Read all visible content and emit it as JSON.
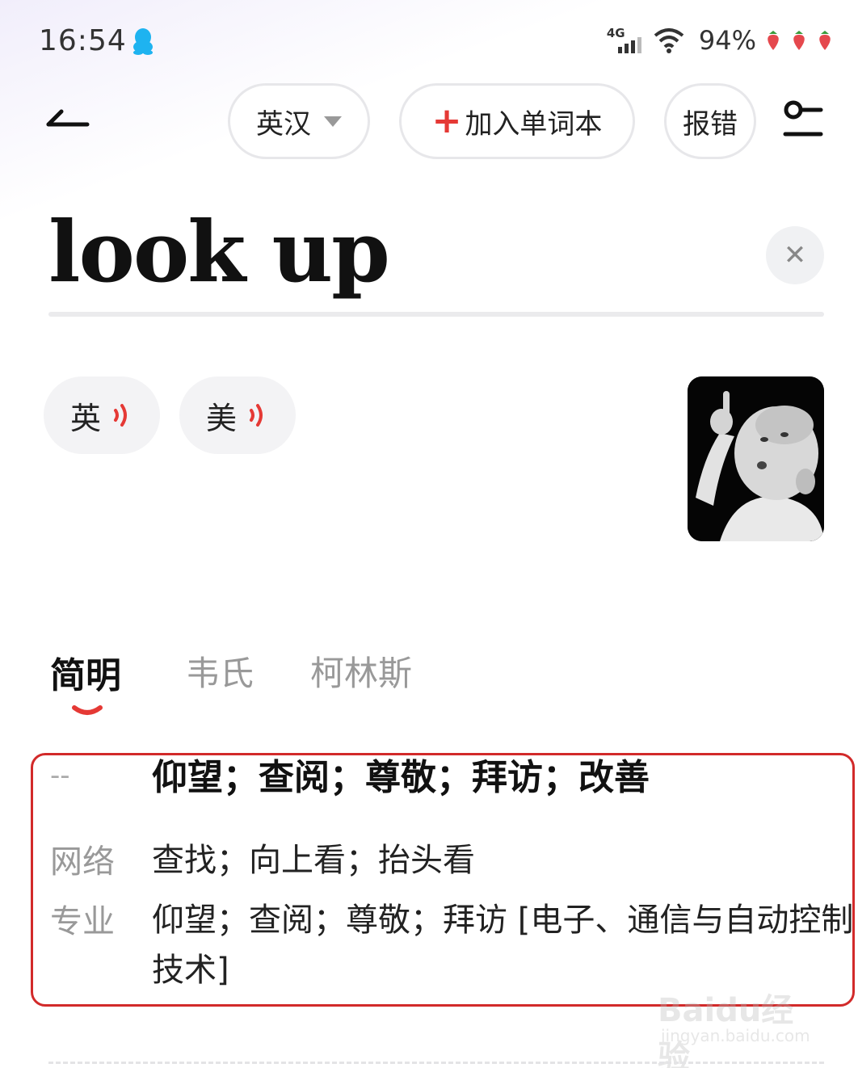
{
  "status_bar": {
    "time": "16:54",
    "network": "4G",
    "battery": "94%"
  },
  "toolbar": {
    "language_label": "英汉",
    "add_label": "加入单词本",
    "add_plus": "+",
    "report_label": "报错"
  },
  "entry": {
    "headword": "look up",
    "clear_symbol": "✕"
  },
  "pronunciation": {
    "uk_label": "英",
    "us_label": "美"
  },
  "tabs": [
    {
      "label": "简明"
    },
    {
      "label": "韦氏"
    },
    {
      "label": "柯林斯"
    }
  ],
  "definitions": [
    {
      "label": "--",
      "text": "仰望；查阅；尊敬；拜访；改善"
    },
    {
      "label": "网络",
      "text": "查找；向上看；抬头看"
    },
    {
      "label": "专业",
      "text": "仰望；查阅；尊敬；拜访 [电子、通信与自动控制技术]"
    }
  ],
  "watermark": {
    "brand": "Baidu经验",
    "url": "jingyan.baidu.com"
  },
  "colors": {
    "accent": "#e53935",
    "highlight_box": "#d22a2a",
    "qq_icon": "#1eb3f0"
  }
}
